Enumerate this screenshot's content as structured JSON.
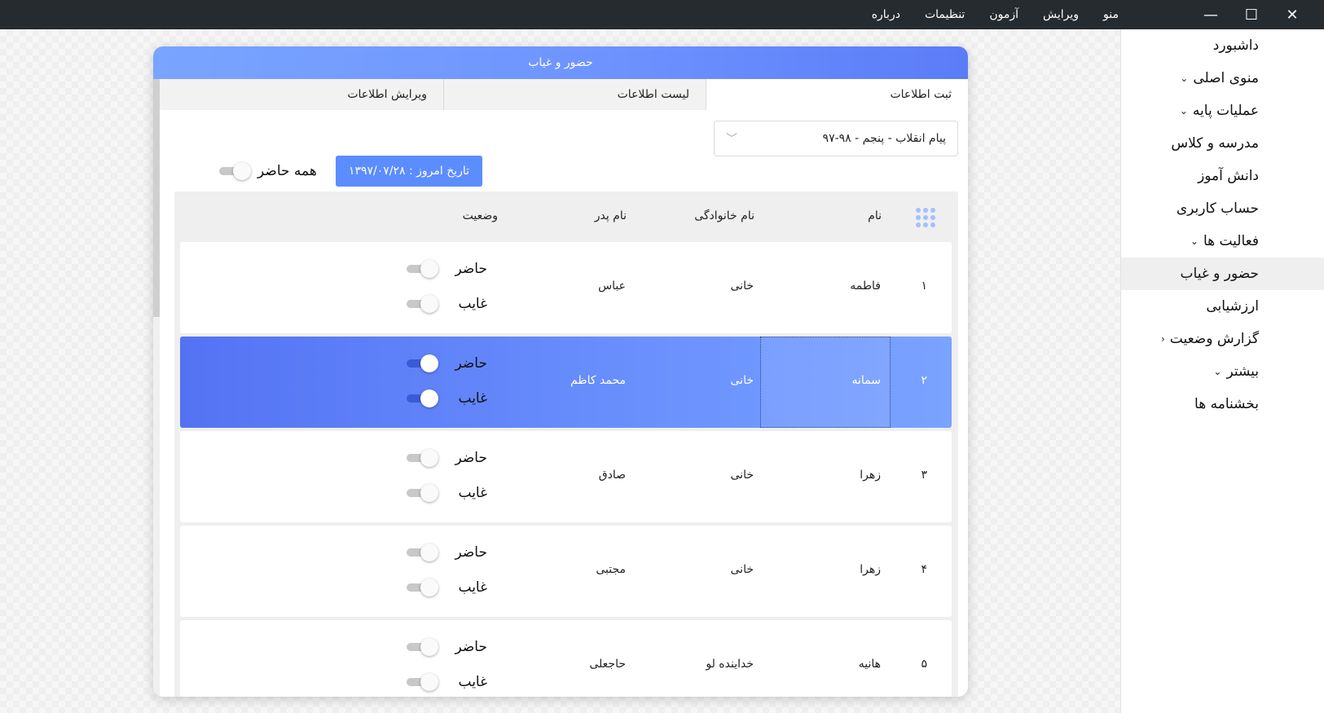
{
  "window": {
    "menu": [
      "منو",
      "ویرایش",
      "آزمون",
      "تنظیمات",
      "درباره"
    ]
  },
  "sidebar": {
    "items": [
      {
        "label": "داشبورد",
        "chevron": ""
      },
      {
        "label": "منوی اصلی",
        "chevron": "down"
      },
      {
        "label": "عملیات پایه",
        "chevron": "down"
      },
      {
        "label": "مدرسه و کلاس",
        "chevron": ""
      },
      {
        "label": "دانش آموز",
        "chevron": ""
      },
      {
        "label": "حساب کاربری",
        "chevron": ""
      },
      {
        "label": "فعالیت ها",
        "chevron": "down"
      },
      {
        "label": "حضور و غیاب",
        "chevron": "",
        "active": true
      },
      {
        "label": "ارزشیابی",
        "chevron": ""
      },
      {
        "label": "گزارش وضعیت",
        "chevron": "left"
      },
      {
        "label": "بیشتر",
        "chevron": "down"
      },
      {
        "label": "بخشنامه ها",
        "chevron": ""
      }
    ]
  },
  "card": {
    "title": "حضور و غیاب",
    "tabs": [
      "ثبت اطلاعات",
      "لیست اطلاعات",
      "ویرایش اطلاعات"
    ],
    "active_tab": 0,
    "select_value": "پیام انقلاب - پنجم - ۹۸-۹۷",
    "date_label": "تاریخ امروز : ۱۳۹۷/۰۷/۲۸",
    "all_present_label": "همه حاضر",
    "columns": {
      "name": "نام",
      "family": "نام خانوادگی",
      "father": "نام پدر",
      "status": "وضعیت"
    },
    "present_label": "حاضر",
    "absent_label": "غایب",
    "rows": [
      {
        "num": "۱",
        "name": "فاطمه",
        "family": "خانی",
        "father": "عباس",
        "present": false,
        "absent": false
      },
      {
        "num": "۲",
        "name": "سمانه",
        "family": "خانی",
        "father": "محمد کاظم",
        "present": true,
        "absent": true,
        "selected": true
      },
      {
        "num": "۳",
        "name": "زهرا",
        "family": "خانی",
        "father": "صادق",
        "present": false,
        "absent": false
      },
      {
        "num": "۴",
        "name": "زهرا",
        "family": "خانی",
        "father": "مجتبی",
        "present": false,
        "absent": false
      },
      {
        "num": "۵",
        "name": "هانیه",
        "family": "خداینده لو",
        "father": "حاجعلی",
        "present": false,
        "absent": false
      }
    ]
  },
  "colors": {
    "accent": "#5c8dff",
    "titlebar": "#262b2f",
    "toggle_on": "#3b5bd6"
  }
}
